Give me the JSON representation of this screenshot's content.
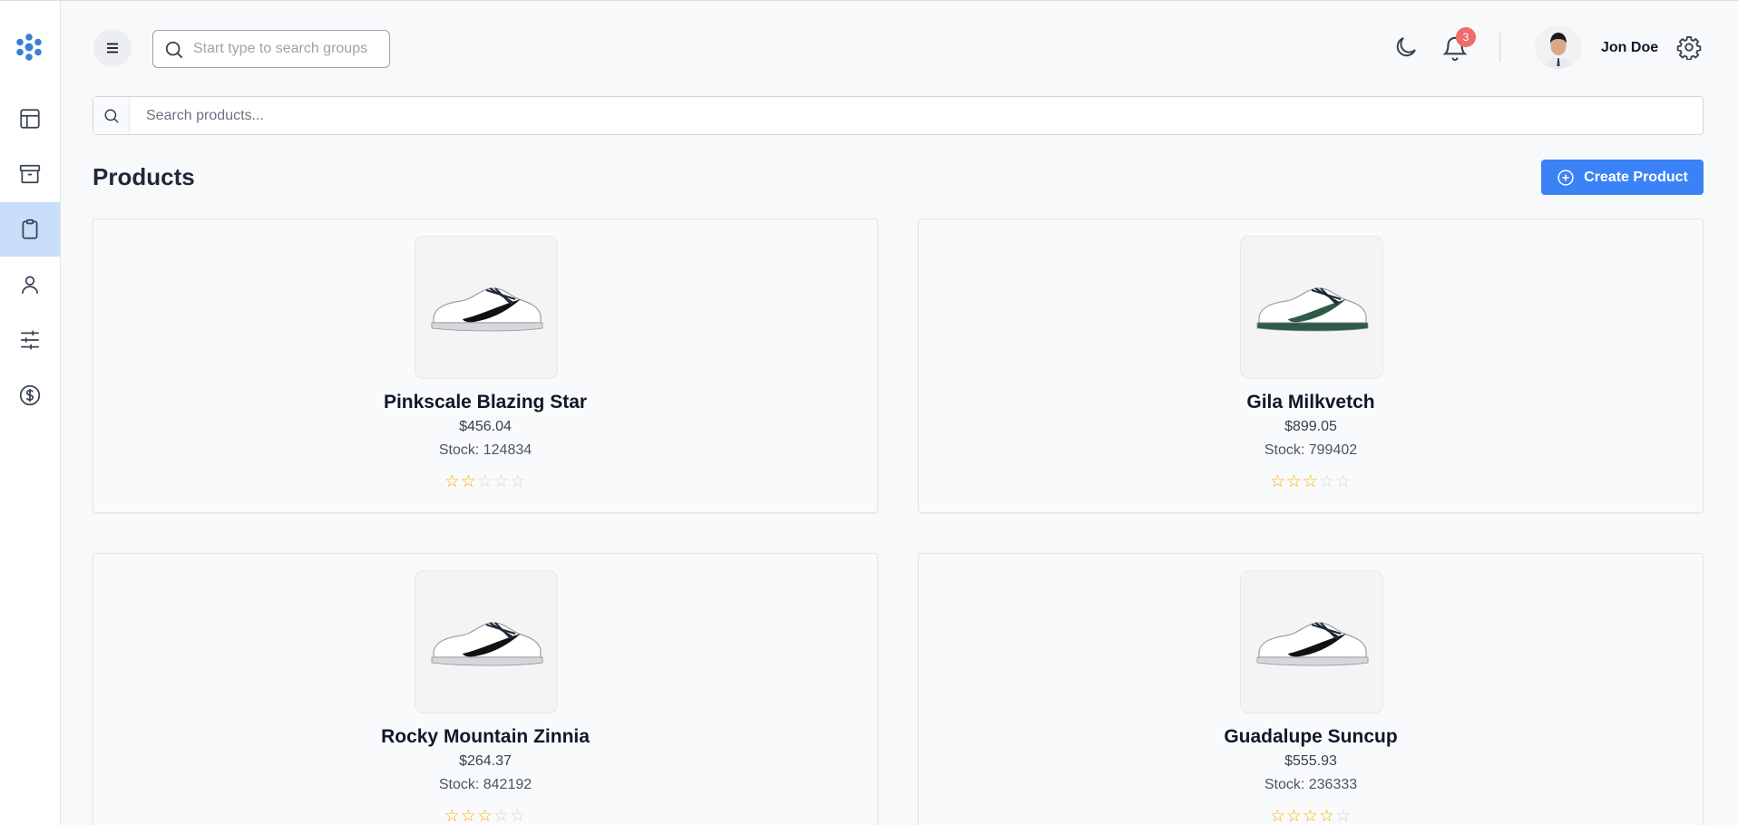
{
  "header": {
    "group_search_placeholder": "Start type to search groups",
    "notification_count": "3",
    "user_name": "Jon Doe"
  },
  "sidebar": {
    "items": [
      {
        "icon": "layout-icon"
      },
      {
        "icon": "archive-icon"
      },
      {
        "icon": "clipboard-icon",
        "active": true
      },
      {
        "icon": "user-icon"
      },
      {
        "icon": "sliders-icon"
      },
      {
        "icon": "dollar-icon"
      }
    ]
  },
  "products_page": {
    "search_placeholder": "Search products...",
    "title": "Products",
    "create_label": "Create Product"
  },
  "products": [
    {
      "name": "Pinkscale Blazing Star",
      "price": "$456.04",
      "stock": "Stock: 124834",
      "rating": 2,
      "swoosh": "#111111",
      "sole": "#d5d7da"
    },
    {
      "name": "Gila Milkvetch",
      "price": "$899.05",
      "stock": "Stock: 799402",
      "rating": 3,
      "swoosh": "#2f5a45",
      "sole": "#2f5a45"
    },
    {
      "name": "Rocky Mountain Zinnia",
      "price": "$264.37",
      "stock": "Stock: 842192",
      "rating": 3,
      "swoosh": "#111111",
      "sole": "#d5d7da"
    },
    {
      "name": "Guadalupe Suncup",
      "price": "$555.93",
      "stock": "Stock: 236333",
      "rating": 4,
      "swoosh": "#111111",
      "sole": "#d5d7da"
    }
  ],
  "colors": {
    "accent": "#3b82f6",
    "active_nav": "#c9def9",
    "badge": "#f06b6b",
    "star": "#f5b301"
  }
}
